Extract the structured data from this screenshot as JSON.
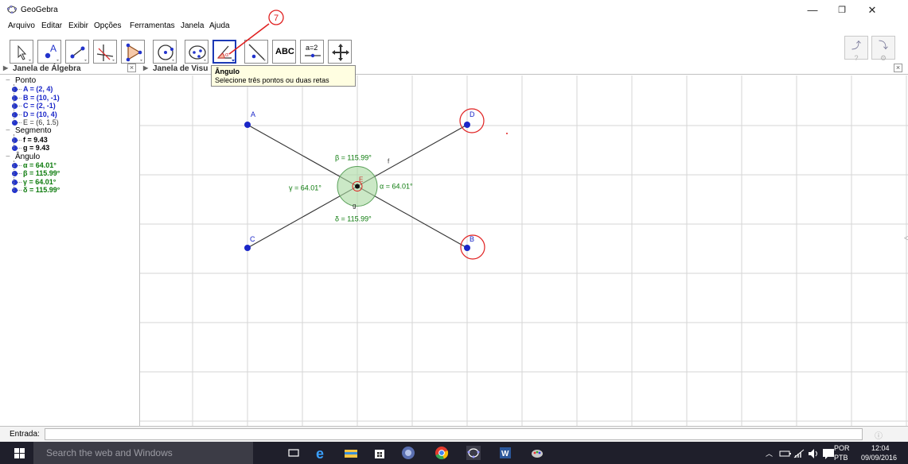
{
  "window": {
    "title": "GeoGebra",
    "controls": [
      "—",
      "❐",
      "✕"
    ]
  },
  "menu": [
    "Arquivo",
    "Editar",
    "Exibir",
    "Opções",
    "Ferramentas",
    "Janela",
    "Ajuda"
  ],
  "annotation": {
    "label": "7"
  },
  "toolbar": {
    "tools": [
      "move",
      "point",
      "segment",
      "perpendicular-line",
      "polygon",
      "circle",
      "ellipse",
      "angle",
      "reflect",
      "text",
      "slider",
      "move-graphics"
    ],
    "text_tool_label": "ABC",
    "slider_tool_label": "a=2",
    "undo_label": "⤴",
    "redo_label": "⤵",
    "help_label": "?",
    "settings_label": "⚙"
  },
  "tooltip": {
    "title": "Ângulo",
    "text": "Selecione três pontos ou duas retas"
  },
  "algebra": {
    "header": "Janela de Álgebra",
    "categories": [
      {
        "name": "Ponto",
        "items": [
          {
            "text": "A = (2, 4)",
            "color": "#1a26c8",
            "bold": true
          },
          {
            "text": "B = (10, -1)",
            "color": "#1a26c8",
            "bold": true
          },
          {
            "text": "C = (2, -1)",
            "color": "#1a26c8",
            "bold": true
          },
          {
            "text": "D = (10, 4)",
            "color": "#1a26c8",
            "bold": true
          },
          {
            "text": "E = (6, 1.5)",
            "color": "#333333",
            "bold": false
          }
        ]
      },
      {
        "name": "Segmento",
        "items": [
          {
            "text": "f = 9.43",
            "color": "#000000",
            "bold": true
          },
          {
            "text": "g = 9.43",
            "color": "#000000",
            "bold": true
          }
        ]
      },
      {
        "name": "Ângulo",
        "items": [
          {
            "text": "α = 64.01°",
            "color": "#0b7a0b",
            "bold": true
          },
          {
            "text": "β = 115.99°",
            "color": "#0b7a0b",
            "bold": true
          },
          {
            "text": "γ = 64.01°",
            "color": "#0b7a0b",
            "bold": true
          },
          {
            "text": "δ = 115.99°",
            "color": "#0b7a0b",
            "bold": true
          }
        ]
      }
    ]
  },
  "graphics": {
    "header": "Janela de Visualização",
    "header_visible": "Janela de Visu",
    "point_labels": {
      "A": "A",
      "B": "B",
      "C": "C",
      "D": "D",
      "E": "E"
    },
    "segment_labels": {
      "f": "f",
      "g": "g"
    },
    "angle_labels": {
      "alpha": "α = 64.01°",
      "beta": "β = 115.99°",
      "gamma": "γ = 64.01°",
      "delta": "δ = 115.99°"
    },
    "colors": {
      "point": "#1a26c8",
      "angle_fill": "#a8d8a0",
      "angle_text": "#0b7a0b",
      "highlight": "#e02020",
      "grid": "#d6d6d6"
    }
  },
  "input": {
    "label": "Entrada:",
    "value": "",
    "help": "ⓘ"
  },
  "taskbar": {
    "search_placeholder": "Search the web and Windows",
    "lang_top": "POR",
    "lang_bottom": "PTB",
    "time": "12:04",
    "date": "09/09/2016"
  }
}
